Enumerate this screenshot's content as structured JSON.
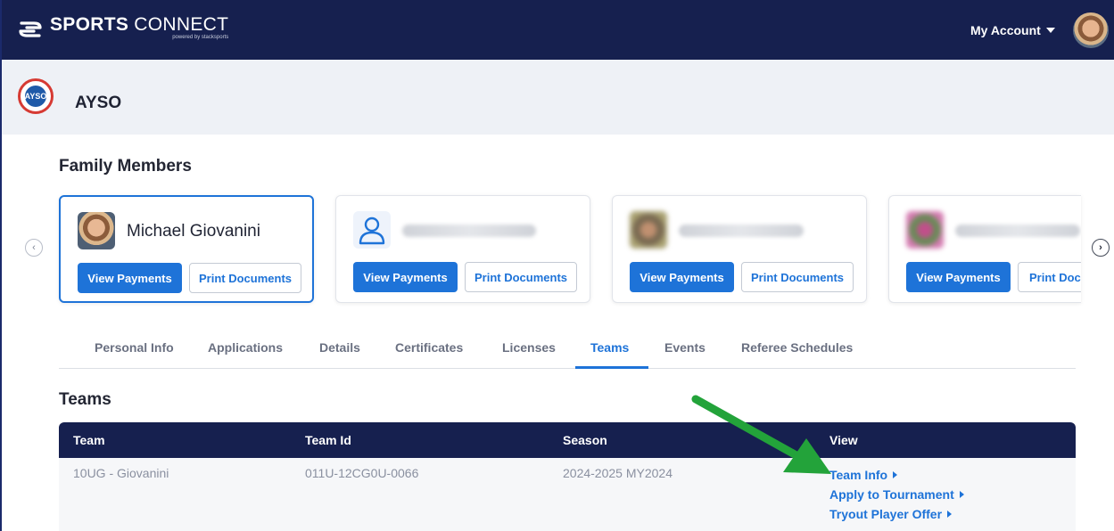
{
  "header": {
    "brand_bold": "SPORTS",
    "brand_light": "CONNECT",
    "brand_sub": "powered by stacksports",
    "account_label": "My Account"
  },
  "org": {
    "name": "AYSO",
    "logo_text": "AYSO"
  },
  "family": {
    "title": "Family Members",
    "members": [
      {
        "name": "Michael Giovanini",
        "pay_label": "View Payments",
        "docs_label": "Print Documents"
      },
      {
        "name": "",
        "pay_label": "View Payments",
        "docs_label": "Print Documents"
      },
      {
        "name": "",
        "pay_label": "View Payments",
        "docs_label": "Print Documents"
      },
      {
        "name": "",
        "pay_label": "View Payments",
        "docs_label": "Print Docu"
      }
    ]
  },
  "tabs": [
    {
      "label": "Personal Info"
    },
    {
      "label": "Applications"
    },
    {
      "label": "Details"
    },
    {
      "label": "Certificates"
    },
    {
      "label": "Licenses"
    },
    {
      "label": "Teams"
    },
    {
      "label": "Events"
    },
    {
      "label": "Referee Schedules"
    }
  ],
  "active_tab": "Teams",
  "teams": {
    "title": "Teams",
    "columns": [
      "Team",
      "Team Id",
      "Season",
      "View"
    ],
    "rows": [
      {
        "team": "10UG - Giovanini",
        "team_id": "011U-12CG0U-0066",
        "season": "2024-2025 MY2024",
        "links": [
          "Team Info",
          "Apply to Tournament",
          "Tryout Player Offer"
        ]
      }
    ]
  },
  "colors": {
    "navy": "#16204f",
    "primary": "#1e73d8",
    "arrow": "#23a33a"
  }
}
